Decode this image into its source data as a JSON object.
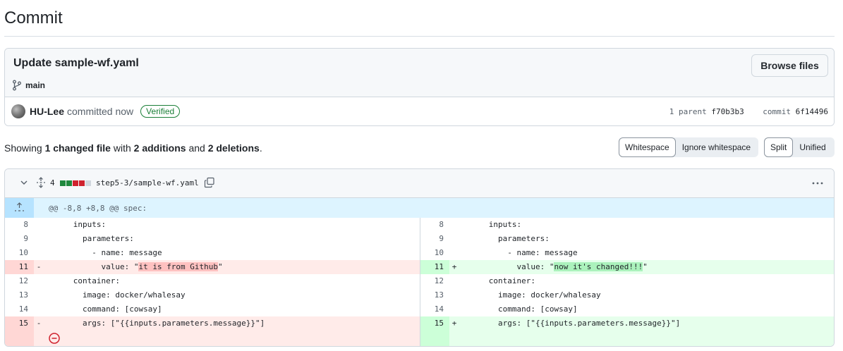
{
  "page_title": "Commit",
  "commit": {
    "message": "Update sample-wf.yaml",
    "branch": "main",
    "browse_label": "Browse files",
    "author": "HU-Lee",
    "action": "committed now",
    "verified": "Verified",
    "parent_label": "1 parent",
    "parent_sha": "f70b3b3",
    "commit_label": "commit",
    "commit_sha": "6f14496"
  },
  "summary": {
    "prefix": "Showing",
    "files": "1 changed file",
    "with": "with",
    "additions": "2 additions",
    "and": "and",
    "deletions": "2 deletions",
    "suffix": "."
  },
  "toggles": {
    "whitespace": "Whitespace",
    "ignore_whitespace": "Ignore whitespace",
    "split": "Split",
    "unified": "Unified"
  },
  "file": {
    "change_count": "4",
    "path": "step5-3/sample-wf.yaml",
    "hunk_header": "@@ -8,8 +8,8 @@ spec:",
    "diffstat_colors": [
      "#1f883d",
      "#1f883d",
      "#cf222e",
      "#cf222e",
      "#d0d7de"
    ]
  },
  "left_lines": [
    {
      "n": "8",
      "m": "",
      "pre": "      inputs:",
      "hl": "",
      "post": ""
    },
    {
      "n": "9",
      "m": "",
      "pre": "        parameters:",
      "hl": "",
      "post": ""
    },
    {
      "n": "10",
      "m": "",
      "pre": "          - name: message",
      "hl": "",
      "post": ""
    },
    {
      "n": "11",
      "m": "-",
      "pre": "            value: \"",
      "hl": "it is from Github",
      "post": "\""
    },
    {
      "n": "12",
      "m": "",
      "pre": "      container:",
      "hl": "",
      "post": ""
    },
    {
      "n": "13",
      "m": "",
      "pre": "        image: docker/whalesay",
      "hl": "",
      "post": ""
    },
    {
      "n": "14",
      "m": "",
      "pre": "        command: [cowsay]",
      "hl": "",
      "post": ""
    },
    {
      "n": "15",
      "m": "-",
      "pre": "        args: [\"{{inputs.parameters.message}}\"]",
      "hl": "",
      "post": ""
    }
  ],
  "right_lines": [
    {
      "n": "8",
      "m": "",
      "pre": "      inputs:",
      "hl": "",
      "post": ""
    },
    {
      "n": "9",
      "m": "",
      "pre": "        parameters:",
      "hl": "",
      "post": ""
    },
    {
      "n": "10",
      "m": "",
      "pre": "          - name: message",
      "hl": "",
      "post": ""
    },
    {
      "n": "11",
      "m": "+",
      "pre": "            value: \"",
      "hl": "now it's changed!!!",
      "post": "\""
    },
    {
      "n": "12",
      "m": "",
      "pre": "      container:",
      "hl": "",
      "post": ""
    },
    {
      "n": "13",
      "m": "",
      "pre": "        image: docker/whalesay",
      "hl": "",
      "post": ""
    },
    {
      "n": "14",
      "m": "",
      "pre": "        command: [cowsay]",
      "hl": "",
      "post": ""
    },
    {
      "n": "15",
      "m": "+",
      "pre": "        args: [\"{{inputs.parameters.message}}\"]",
      "hl": "",
      "post": ""
    }
  ]
}
